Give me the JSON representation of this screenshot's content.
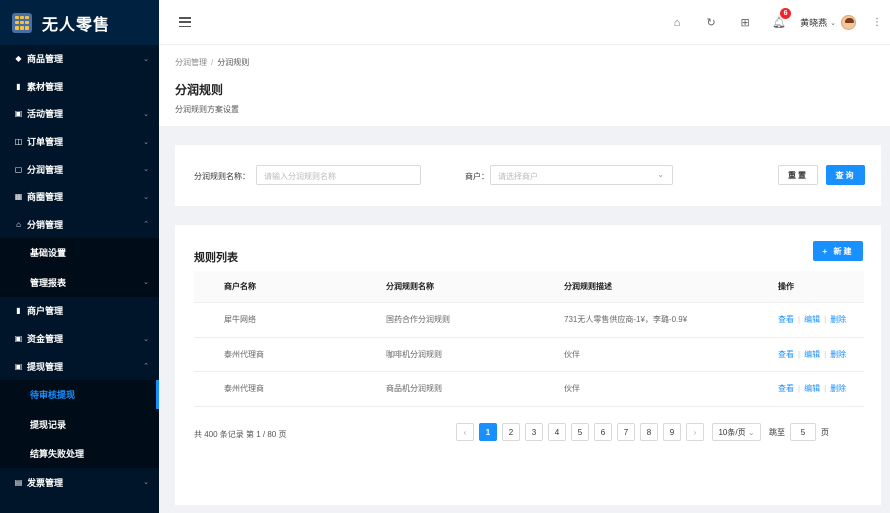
{
  "app": {
    "title": "无人零售"
  },
  "sidebar": {
    "items": [
      {
        "label": "商品管理",
        "icon": "tag-icon",
        "glyph": "◆",
        "arrow": "⌄"
      },
      {
        "label": "素材管理",
        "icon": "file-icon",
        "glyph": "▮",
        "arrow": ""
      },
      {
        "label": "活动管理",
        "icon": "calendar-icon",
        "glyph": "▣",
        "arrow": "⌄"
      },
      {
        "label": "订单管理",
        "icon": "order-icon",
        "glyph": "◫",
        "arrow": "⌄"
      },
      {
        "label": "分润管理",
        "icon": "share-icon",
        "glyph": "▢",
        "arrow": "⌄"
      },
      {
        "label": "商圈管理",
        "icon": "grid-icon",
        "glyph": "▦",
        "arrow": "⌄"
      },
      {
        "label": "分销管理",
        "icon": "home-icon",
        "glyph": "⌂",
        "arrow": "⌃"
      }
    ],
    "sub_distribution": [
      {
        "label": "基础设置",
        "arrow": ""
      },
      {
        "label": "管理报表",
        "arrow": "⌄"
      }
    ],
    "items2": [
      {
        "label": "商户管理",
        "icon": "user-icon",
        "glyph": "▮",
        "arrow": ""
      },
      {
        "label": "资金管理",
        "icon": "wallet-icon",
        "glyph": "▣",
        "arrow": "⌄"
      },
      {
        "label": "提现管理",
        "icon": "withdraw-icon",
        "glyph": "▣",
        "arrow": "⌃"
      }
    ],
    "sub_withdraw": [
      {
        "label": "待审核提现",
        "active": true
      },
      {
        "label": "提现记录",
        "active": false
      },
      {
        "label": "结算失败处理",
        "active": false
      }
    ],
    "items3": [
      {
        "label": "发票管理",
        "icon": "invoice-icon",
        "glyph": "▤",
        "arrow": "⌄"
      }
    ]
  },
  "header": {
    "notification_count": "6",
    "user_name": "黄晓燕"
  },
  "page": {
    "breadcrumb": [
      "分润管理",
      "分润规则"
    ],
    "title": "分润规则",
    "description": "分润规则方案设置"
  },
  "filter": {
    "name_label": "分润规则名称：",
    "name_placeholder": "请输入分润规则名称",
    "merchant_label": "商户：",
    "merchant_placeholder": "请选择商户",
    "reset_label": "重置",
    "search_label": "查询"
  },
  "list": {
    "title": "规则列表",
    "new_label": "+ 新建",
    "columns": [
      "商户名称",
      "分润规则名称",
      "分润规则描述",
      "操作"
    ],
    "rows": [
      {
        "merchant": "犀牛网络",
        "rule": "国药合作分润规则",
        "desc": "731无人零售供应商-1¥，李璐-0.9¥"
      },
      {
        "merchant": "泰州代理商",
        "rule": "咖啡机分润规则",
        "desc": "伙伴"
      },
      {
        "merchant": "泰州代理商",
        "rule": "商品机分润规则",
        "desc": "伙伴"
      }
    ],
    "actions": {
      "view": "查看",
      "edit": "编辑",
      "delete": "删除"
    }
  },
  "pagination": {
    "total_text": "共 400 条记录 第 1 / 80 页",
    "pages": [
      "1",
      "2",
      "3",
      "4",
      "5",
      "6",
      "7",
      "8",
      "9"
    ],
    "current": "1",
    "page_size": "10条/页",
    "jump_label": "跳至",
    "jump_value": "5",
    "page_suffix": "页"
  },
  "colors": {
    "primary": "#1890ff",
    "sidebar": "#001529",
    "badge": "#f5222d"
  }
}
